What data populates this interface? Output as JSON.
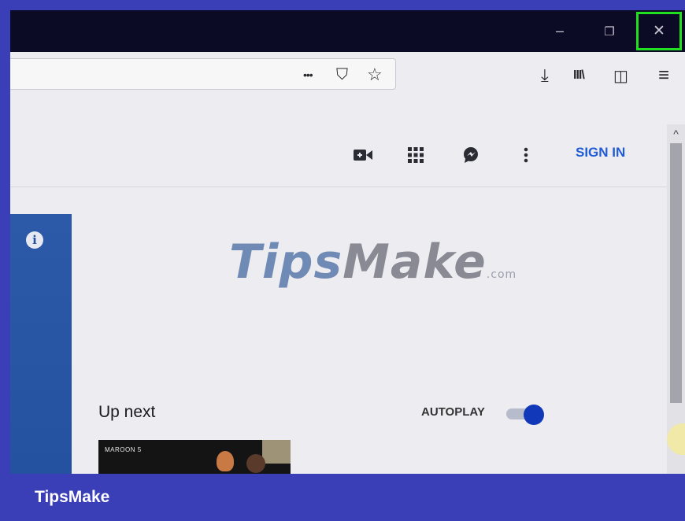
{
  "window": {
    "minimize_glyph": "–",
    "restore_glyph": "❐",
    "close_glyph": "✕"
  },
  "toolbar": {
    "more_glyph": "•••",
    "pocket_glyph": "⛉",
    "star_glyph": "☆",
    "download_glyph": "⤓",
    "library_glyph": "III\\",
    "sidebar_glyph": "◫",
    "menu_glyph": "≡"
  },
  "header": {
    "create_icon": "video-camera-plus-icon",
    "apps_icon": "apps-grid-icon",
    "messages_icon": "message-bubble-icon",
    "more_icon": "vertical-dots-icon",
    "sign_in_label": "SIGN IN"
  },
  "player": {
    "info_glyph": "i"
  },
  "watermark": {
    "part1": "Tips",
    "part2": "Make",
    "part3": ".com"
  },
  "sidebar": {
    "up_next_label": "Up next",
    "autoplay_label": "AUTOPLAY",
    "autoplay_on": true,
    "thumbnail_text": "MAROON 5"
  },
  "scroll": {
    "up_glyph": "^"
  },
  "footer": {
    "brand": "TipsMake"
  },
  "colors": {
    "frame": "#3a3fb8",
    "titlebar": "#0b0b26",
    "close_highlight": "#20e020",
    "sign_in": "#1f5bd6",
    "toggle_knob": "#1038b8"
  }
}
